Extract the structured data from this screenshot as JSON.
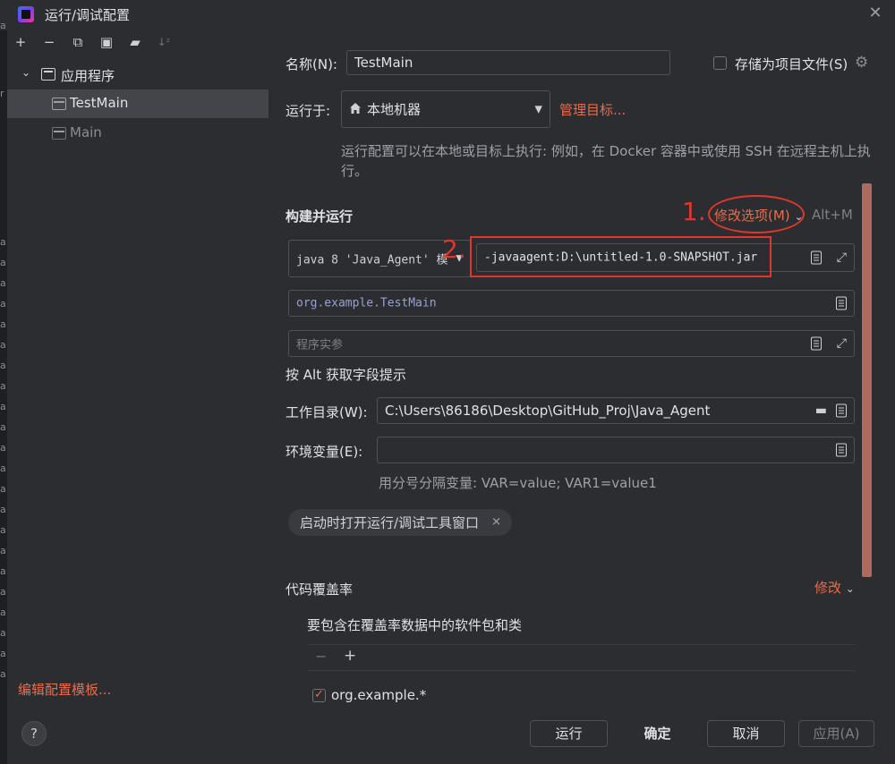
{
  "window": {
    "title": "运行/调试配置"
  },
  "left_strip": {
    "letters": [
      "a",
      "r",
      "a",
      "a",
      "a",
      "a",
      "a",
      "a",
      "a",
      "a",
      "a",
      "a",
      "a",
      "a",
      "a",
      "a",
      "a",
      "a",
      "a",
      "a",
      "a",
      "a",
      "a",
      "a"
    ]
  },
  "tree": {
    "group_label": "应用程序",
    "items": [
      {
        "label": "TestMain"
      },
      {
        "label": "Main"
      }
    ]
  },
  "left_footer": {
    "edit_templates": "编辑配置模板...",
    "help": "?"
  },
  "config": {
    "name_label": "名称(N):",
    "name_value": "TestMain",
    "store_label": "存储为项目文件(S)",
    "run_on_label": "运行于:",
    "run_on_value": "本地机器",
    "manage_targets": "管理目标...",
    "run_on_hint": "运行配置可以在本地或目标上执行: 例如，在 Docker 容器中或使用 SSH 在远程主机上执行。",
    "build_run_title": "构建并运行",
    "modify_options": "修改选项(M)",
    "modify_shortcut": "Alt+M",
    "jre_value": "java 8 'Java_Agent' 模",
    "vm_options_value": "-javaagent:D:\\untitled-1.0-SNAPSHOT.jar",
    "main_class_value": "org.example.TestMain",
    "program_args_placeholder": "程序实参",
    "alt_hint": "按 Alt 获取字段提示",
    "work_dir_label": "工作目录(W):",
    "work_dir_value": "C:\\Users\\86186\\Desktop\\GitHub_Proj\\Java_Agent",
    "env_label": "环境变量(E):",
    "env_value": "",
    "env_hint": "用分号分隔变量: VAR=value; VAR1=value1",
    "chip_label": "启动时打开运行/调试工具窗口",
    "coverage_title": "代码覆盖率",
    "coverage_modify": "修改",
    "coverage_sub": "要包含在覆盖率数据中的软件包和类",
    "coverage_item": "org.example.*"
  },
  "annotations": {
    "step1": "1.",
    "step2": "2."
  },
  "buttons": {
    "run": "运行",
    "ok": "确定",
    "cancel": "取消",
    "apply": "应用(A)"
  },
  "colors": {
    "background": "#2b2d30",
    "accent_link": "#e96c4c",
    "annotation_red": "#e0362c",
    "selection": "#43454a"
  }
}
